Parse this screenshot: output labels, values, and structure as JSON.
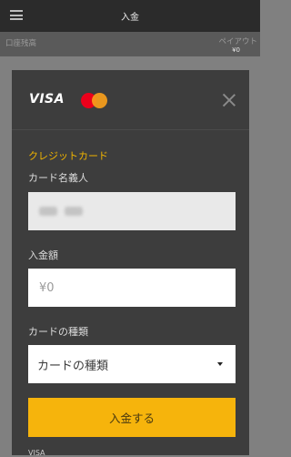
{
  "header": {
    "title": "入金",
    "menu_icon": "hamburger-menu-icon"
  },
  "balance": {
    "left_label": "口座残高",
    "right_label": "ペイアウト",
    "right_value": "¥0"
  },
  "modal": {
    "brand_visa": "VISA",
    "brand_mastercard_icon": "mastercard-icon",
    "close_icon": "close-icon",
    "section_title": "クレジットカード",
    "cardholder_label": "カード名義人",
    "amount_label": "入金額",
    "amount_placeholder": "¥0",
    "card_type_label": "カードの種類",
    "card_type_selected": "カードの種類",
    "submit_label": "入金する",
    "footer_text": "VISA"
  },
  "colors": {
    "accent": "#f0b400",
    "button": "#f6b40c",
    "modal_bg": "#3d3d3d",
    "topbar": "#2b2b2b"
  }
}
